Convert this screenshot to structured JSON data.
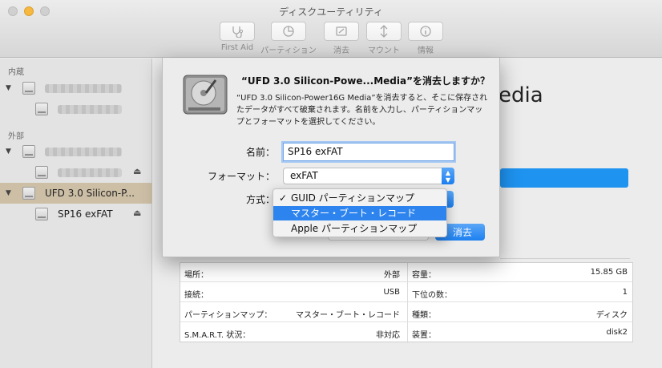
{
  "window": {
    "title": "ディスクユーティリティ"
  },
  "toolbar": {
    "items": [
      {
        "label": "First Aid",
        "icon": "stethoscope-icon"
      },
      {
        "label": "パーティション",
        "icon": "partition-pie-icon"
      },
      {
        "label": "消去",
        "icon": "erase-icon"
      },
      {
        "label": "マウント",
        "icon": "mount-icon"
      },
      {
        "label": "情報",
        "icon": "info-icon"
      }
    ]
  },
  "sidebar": {
    "internal_header": "内蔵",
    "external_header": "外部",
    "selected_device": "UFD 3.0 Silicon-P...",
    "selected_volume": "SP16 exFAT",
    "selected_color": "#cdbfa6"
  },
  "main": {
    "title_fragment": "edia",
    "info": {
      "left": [
        {
          "key": "場所：",
          "value": "外部"
        },
        {
          "key": "接続：",
          "value": "USB"
        },
        {
          "key": "パーティションマップ：",
          "value": "マスター・ブート・レコード"
        },
        {
          "key": "S.M.A.R.T. 状況：",
          "value": "非対応"
        }
      ],
      "right": [
        {
          "key": "容量：",
          "value": "15.85 GB"
        },
        {
          "key": "下位の数：",
          "value": "1"
        },
        {
          "key": "種類：",
          "value": "ディスク"
        },
        {
          "key": "装置：",
          "value": "disk2"
        }
      ]
    }
  },
  "dialog": {
    "title": "“UFD 3.0 Silicon-Powe...Media”を消去しますか？",
    "message": "“UFD 3.0 Silicon-Power16G Media”を消去すると、そこに保存されたデータがすべて破棄されます。名前を入力し、パーティションマップとフォーマットを選択してください。",
    "name_label": "名前：",
    "name_value": "SP16 exFAT",
    "format_label": "フォーマット：",
    "format_value": "exFAT",
    "scheme_label": "方式：",
    "erase_button": "消去",
    "scheme_options": [
      {
        "label": "GUID パーティションマップ",
        "checked": true
      },
      {
        "label": "マスター・ブート・レコード",
        "highlighted": true
      },
      {
        "label": "Apple パーティションマップ"
      }
    ],
    "accent_color": "#1e80f0"
  }
}
